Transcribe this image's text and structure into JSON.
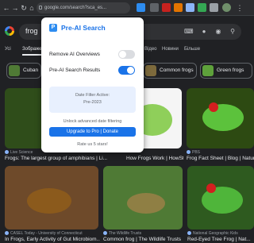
{
  "browser": {
    "url": "google.com/search?sca_es..."
  },
  "search": {
    "query": "frog"
  },
  "tabs": [
    "Усі",
    "Зображення",
    "Відео",
    "Новини",
    "Більше"
  ],
  "chips": [
    {
      "label": "Cuban"
    },
    {
      "label": "Common frogs"
    },
    {
      "label": "Green frogs"
    }
  ],
  "results_row1": [
    {
      "source": "Live Science",
      "title": "Frogs: The largest group of amphibians | Li..."
    },
    {
      "source": "",
      "title": "How Frogs Work | HowStuffW..."
    },
    {
      "source": "PBS",
      "title": "Frog Fact Sheet | Blog | Nature"
    }
  ],
  "results_row2": [
    {
      "source": "CASEL Today - University of Connecticut",
      "title": "In Frogs, Early Activity of Gut Microbiom..."
    },
    {
      "source": "The Wildlife Trusts",
      "title": "Common frog | The Wildlife Trusts"
    },
    {
      "source": "National Geographic Kids",
      "title": "Red-Eyed Tree Frog | Nat..."
    }
  ],
  "popup": {
    "logo": "P",
    "title": "Pre-AI Search",
    "options": [
      {
        "label": "Remove AI Overviews",
        "enabled": false
      },
      {
        "label": "Pre-AI Search Results",
        "enabled": true
      }
    ],
    "filter_line1": "Date Filter Active:",
    "filter_line2": "Pre-2023",
    "unlock_text": "Unlock advanced date filtering",
    "upgrade_label": "Upgrade to Pro | Donate",
    "rate_text": "Rate us 5 stars!"
  },
  "colors": {
    "accent": "#1a73e8",
    "page_bg": "#202124",
    "popup_bg": "#ffffff"
  }
}
